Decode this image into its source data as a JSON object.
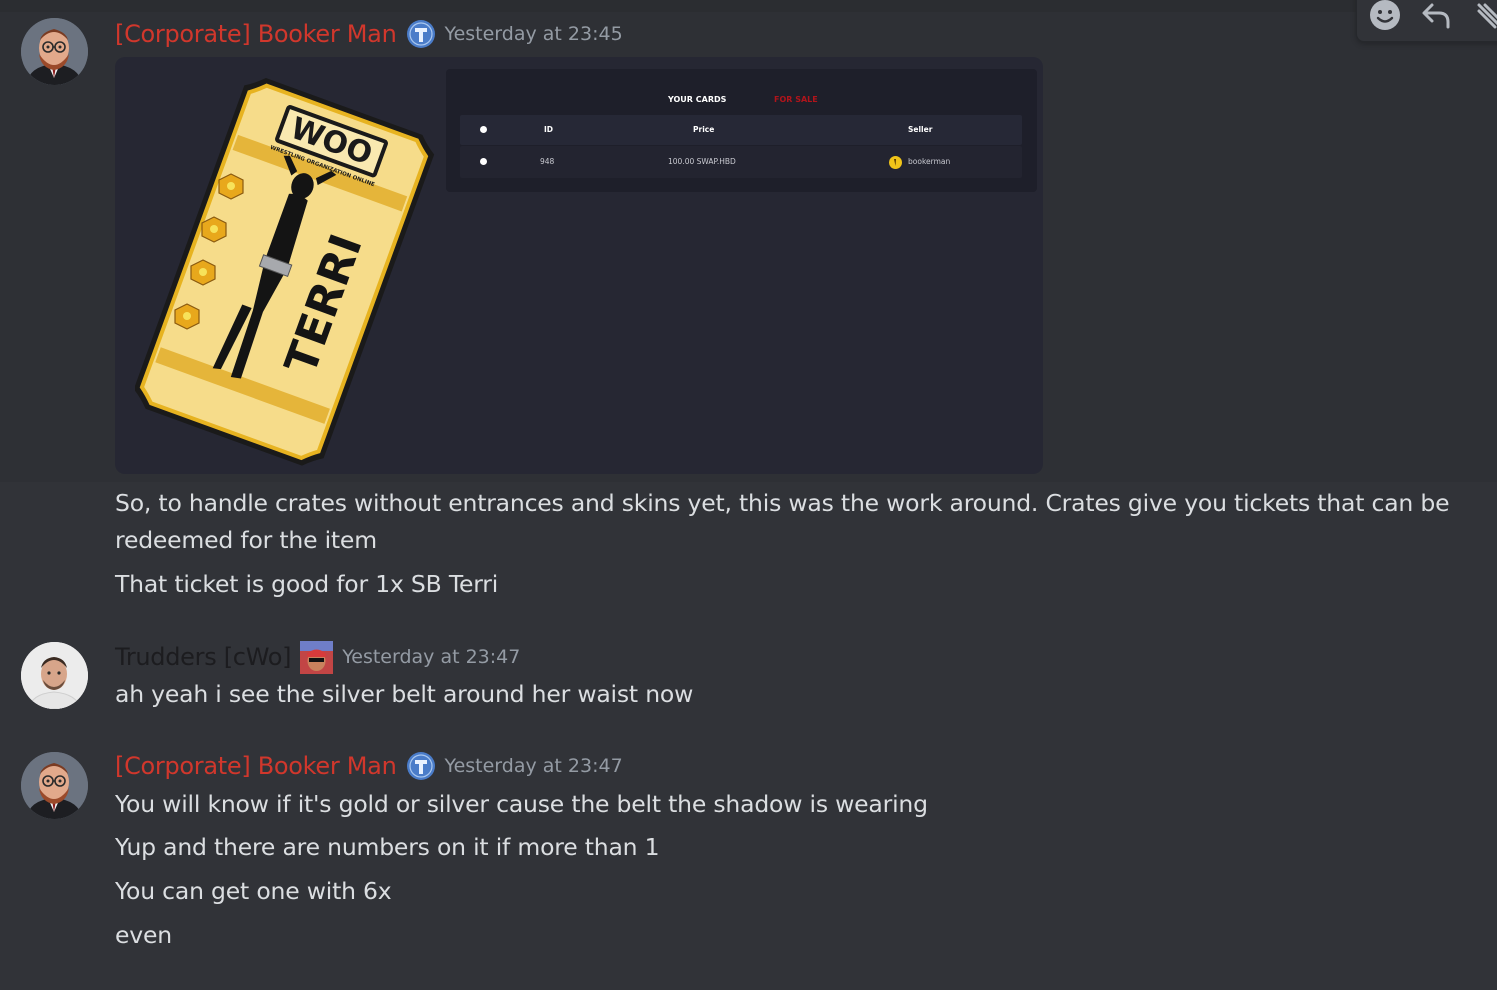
{
  "messages": [
    {
      "author": "[Corporate] Booker Man",
      "timestamp": "Yesterday at 23:45",
      "lines": [
        "So, to handle crates without entrances and skins yet, this was the work around. Crates give you tickets that can be",
        "redeemed for the item",
        "That ticket is good for 1x SB Terri"
      ]
    },
    {
      "author": "Trudders [cWo]",
      "timestamp": "Yesterday at 23:47",
      "lines": [
        "ah yeah i see the silver belt around her waist now"
      ]
    },
    {
      "author": "[Corporate] Booker Man",
      "timestamp": "Yesterday at 23:47",
      "lines": [
        "You will know if it's gold or silver cause the belt the shadow is wearing",
        "Yup and there are numbers on it if more than 1",
        "You can get one with 6x",
        "even"
      ]
    }
  ],
  "embed": {
    "ticket": {
      "logo": "WOO",
      "logo_subtitle": "WRESTLING ORGANIZATION ONLINE",
      "name": "TERRI",
      "stars": 4
    },
    "market": {
      "tabs": [
        "YOUR CARDS",
        "FOR SALE"
      ],
      "active_tab": "FOR SALE",
      "columns": [
        "ID",
        "Price",
        "Seller"
      ],
      "rows": [
        {
          "id": "948",
          "price": "100.00 SWAP.HBD",
          "seller": "bookerman"
        }
      ]
    }
  },
  "toolbar_icons": [
    "add-reaction-icon",
    "reply-icon",
    "more-icon"
  ],
  "colors": {
    "background": "#313338",
    "author_red": "#d1372c",
    "timestamp": "#949ba4",
    "text": "#dbdee1",
    "embed_bg": "#262733",
    "ticket_gold": "#f2d27a",
    "tab_active": "#b0141b"
  }
}
